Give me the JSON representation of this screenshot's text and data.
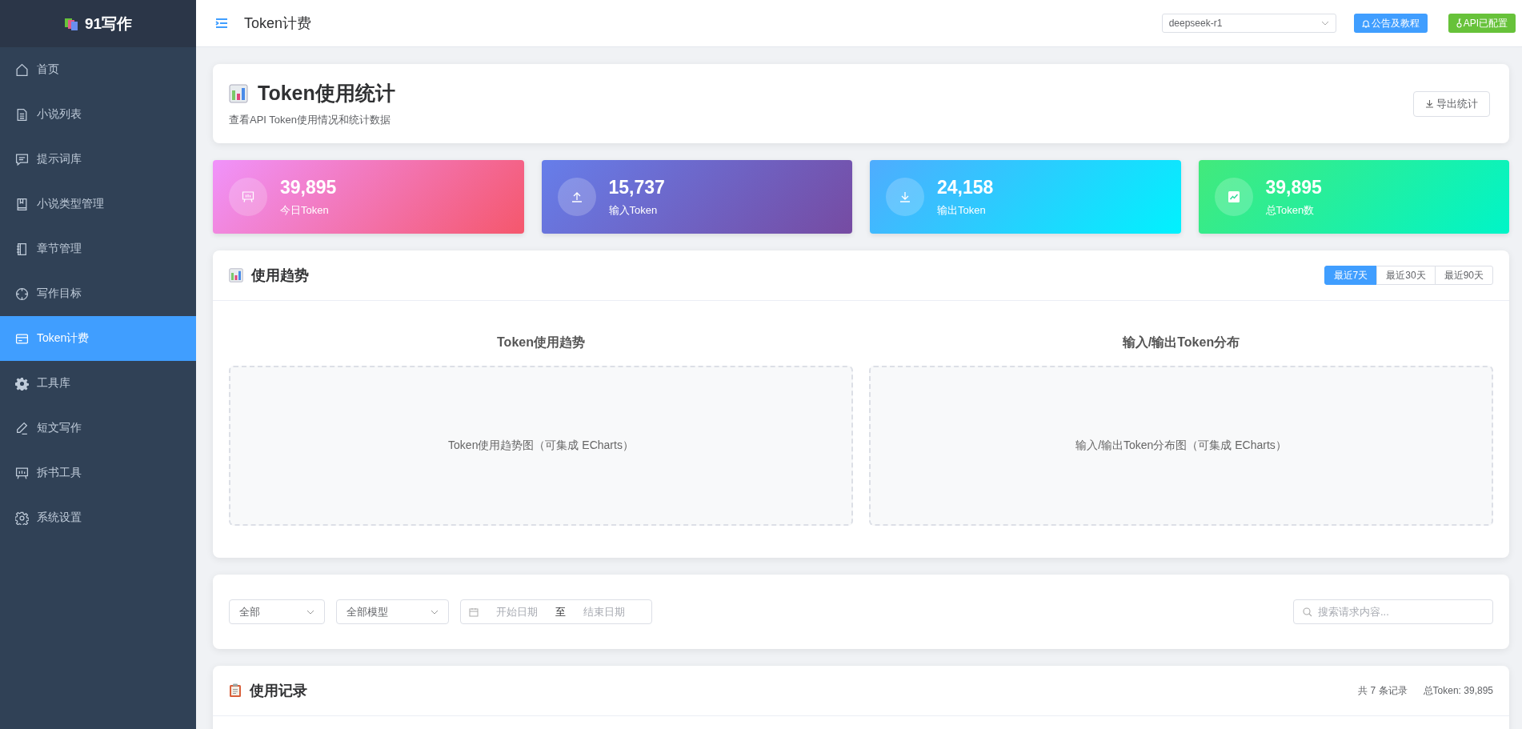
{
  "sidebar": {
    "logo": "91写作",
    "items": [
      {
        "label": "首页",
        "selected": false
      },
      {
        "label": "小说列表",
        "selected": false
      },
      {
        "label": "提示词库",
        "selected": false
      },
      {
        "label": "小说类型管理",
        "selected": false
      },
      {
        "label": "章节管理",
        "selected": false
      },
      {
        "label": "写作目标",
        "selected": false
      },
      {
        "label": "Token计费",
        "selected": true
      },
      {
        "label": "工具库",
        "selected": false
      },
      {
        "label": "短文写作",
        "selected": false
      },
      {
        "label": "拆书工具",
        "selected": false
      },
      {
        "label": "系统设置",
        "selected": false
      }
    ]
  },
  "topbar": {
    "title": "Token计费",
    "model": "deepseek-r1",
    "notice_button": "公告及教程",
    "api_button": "API已配置"
  },
  "header": {
    "title": "Token使用统计",
    "subtitle": "查看API Token使用情况和统计数据",
    "export_button": "导出统计"
  },
  "stats": [
    {
      "kind": "today",
      "value": "39,895",
      "label": "今日Token"
    },
    {
      "kind": "input",
      "value": "15,737",
      "label": "输入Token"
    },
    {
      "kind": "output",
      "value": "24,158",
      "label": "输出Token"
    },
    {
      "kind": "total",
      "value": "39,895",
      "label": "总Token数"
    }
  ],
  "trend": {
    "title": "使用趋势",
    "ranges": [
      {
        "label": "最近7天",
        "selected": true
      },
      {
        "label": "最近30天",
        "selected": false
      },
      {
        "label": "最近90天",
        "selected": false
      }
    ],
    "panels": [
      {
        "title": "Token使用趋势",
        "placeholder": "Token使用趋势图（可集成 ECharts）"
      },
      {
        "title": "输入/输出Token分布",
        "placeholder": "输入/输出Token分布图（可集成 ECharts）"
      }
    ]
  },
  "filters": {
    "type": "全部",
    "model": "全部模型",
    "start_placeholder": "开始日期",
    "separator": "至",
    "end_placeholder": "结束日期",
    "search_placeholder": "搜索请求内容..."
  },
  "records": {
    "title": "使用记录",
    "count": "共 7 条记录",
    "total": "总Token: 39,895"
  }
}
